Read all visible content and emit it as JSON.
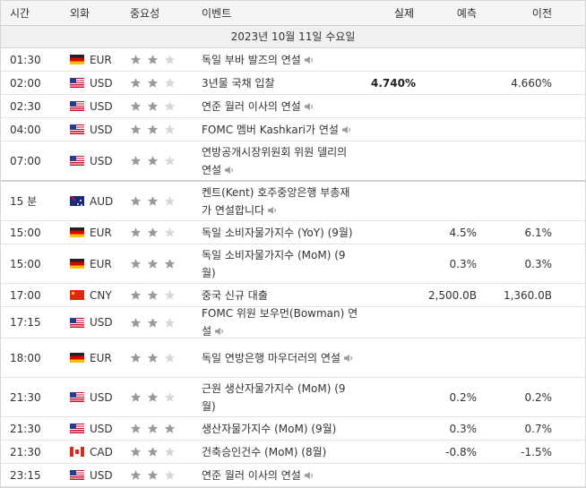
{
  "header": {
    "time": "시간",
    "currency": "외화",
    "importance": "중요성",
    "event": "이벤트",
    "actual": "실제",
    "forecast": "예측",
    "previous": "이전"
  },
  "date_label": "2023년 10월 11일 수요일",
  "colors": {
    "star_on": "#9a9a9a",
    "star_off": "#d8d8d8",
    "speaker": "#9a9a9a"
  },
  "events": [
    {
      "time": "01:30",
      "currency": "EUR",
      "stars": 2,
      "event": "독일 부바 발즈의 연설",
      "speech": true,
      "actual": "",
      "forecast": "",
      "previous": ""
    },
    {
      "time": "02:00",
      "currency": "USD",
      "stars": 2,
      "event": "3년물 국채 입찰",
      "speech": false,
      "actual": "4.740%",
      "forecast": "",
      "previous": "4.660%"
    },
    {
      "time": "02:30",
      "currency": "USD",
      "stars": 2,
      "event": "연준 월러 이사의 연설",
      "speech": true,
      "actual": "",
      "forecast": "",
      "previous": ""
    },
    {
      "time": "04:00",
      "currency": "USD",
      "stars": 2,
      "event": "FOMC 멤버 Kashkari가 연설",
      "speech": true,
      "actual": "",
      "forecast": "",
      "previous": ""
    },
    {
      "time": "07:00",
      "currency": "USD",
      "stars": 2,
      "event": "연방공개시장위원회 위원 델리의 연설",
      "speech": true,
      "actual": "",
      "forecast": "",
      "previous": ""
    },
    {
      "time": "15 분",
      "currency": "AUD",
      "stars": 2,
      "event": "켄트(Kent) 호주중앙은행 부총재가 연설합니다",
      "speech": true,
      "actual": "",
      "forecast": "",
      "previous": ""
    },
    {
      "time": "15:00",
      "currency": "EUR",
      "stars": 2,
      "event": "독일 소비자물가지수 (YoY) (9월)",
      "speech": false,
      "actual": "",
      "forecast": "4.5%",
      "previous": "6.1%"
    },
    {
      "time": "15:00",
      "currency": "EUR",
      "stars": 3,
      "event": "독일 소비자물가지수 (MoM) (9월)",
      "speech": false,
      "actual": "",
      "forecast": "0.3%",
      "previous": "0.3%"
    },
    {
      "time": "17:00",
      "currency": "CNY",
      "stars": 2,
      "event": "중국 신규 대출",
      "speech": false,
      "actual": "",
      "forecast": "2,500.0B",
      "previous": "1,360.0B"
    },
    {
      "time": "17:15",
      "currency": "USD",
      "stars": 2,
      "event": "FOMC 위원 보우먼(Bowman) 연설",
      "speech": true,
      "actual": "",
      "forecast": "",
      "previous": ""
    },
    {
      "time": "18:00",
      "currency": "EUR",
      "stars": 2,
      "event": "독일 연방은행 마우더러의 연설",
      "speech": true,
      "actual": "",
      "forecast": "",
      "previous": ""
    },
    {
      "time": "21:30",
      "currency": "USD",
      "stars": 2,
      "event": "근원 생산자물가지수 (MoM) (9월)",
      "speech": false,
      "actual": "",
      "forecast": "0.2%",
      "previous": "0.2%"
    },
    {
      "time": "21:30",
      "currency": "USD",
      "stars": 3,
      "event": "생산자물가지수 (MoM) (9월)",
      "speech": false,
      "actual": "",
      "forecast": "0.3%",
      "previous": "0.7%"
    },
    {
      "time": "21:30",
      "currency": "CAD",
      "stars": 2,
      "event": "건축승인건수 (MoM) (8월)",
      "speech": false,
      "actual": "",
      "forecast": "-0.8%",
      "previous": "-1.5%"
    },
    {
      "time": "23:15",
      "currency": "USD",
      "stars": 2,
      "event": "연준 월러 이사의 연설",
      "speech": true,
      "actual": "",
      "forecast": "",
      "previous": ""
    }
  ]
}
